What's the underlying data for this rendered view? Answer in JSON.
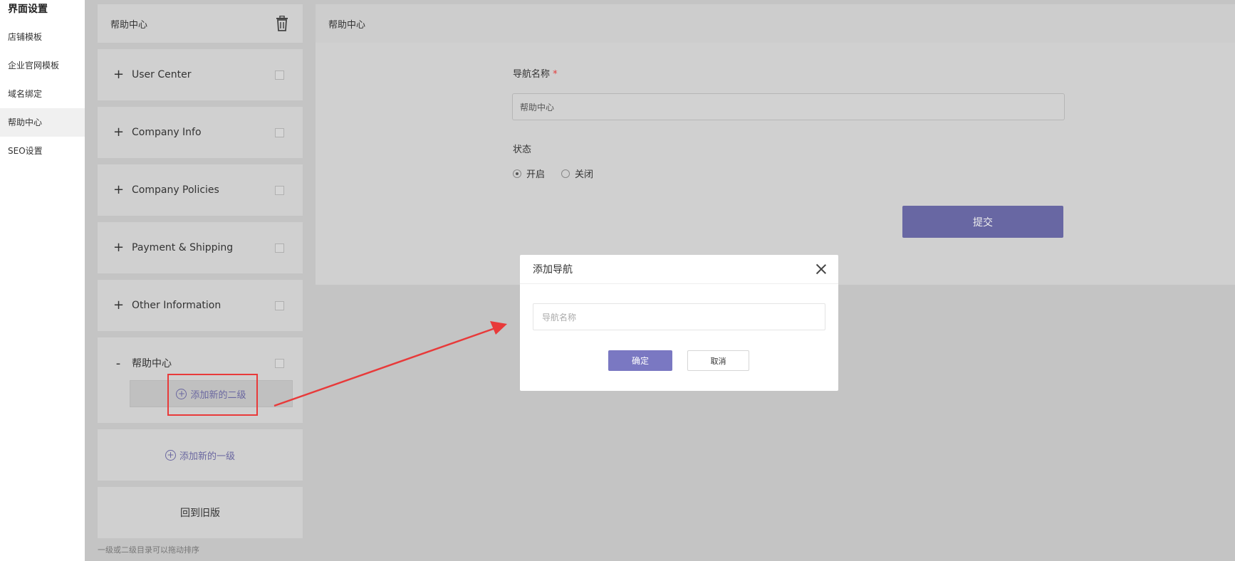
{
  "sidebar": {
    "title": "界面设置",
    "items": [
      {
        "label": "店铺模板"
      },
      {
        "label": "企业官网模板"
      },
      {
        "label": "域名绑定"
      },
      {
        "label": "帮助中心"
      },
      {
        "label": "SEO设置"
      }
    ]
  },
  "left_panel": {
    "title": "帮助中心",
    "rows": [
      {
        "sign": "+",
        "label": "User Center"
      },
      {
        "sign": "+",
        "label": "Company Info"
      },
      {
        "sign": "+",
        "label": "Company Policies"
      },
      {
        "sign": "+",
        "label": "Payment & Shipping"
      },
      {
        "sign": "+",
        "label": "Other Information"
      }
    ],
    "expanded": {
      "sign": "-",
      "label": "帮助中心",
      "add_sub_label": "添加新的二级"
    },
    "add_top_label": "添加新的一级",
    "back_old_label": "回到旧版",
    "hint": "一级或二级目录可以拖动排序"
  },
  "right_panel": {
    "title": "帮助中心",
    "name_label": "导航名称",
    "name_required": "*",
    "name_value": "帮助中心",
    "status_label": "状态",
    "status_options": [
      {
        "label": "开启",
        "selected": true
      },
      {
        "label": "关闭",
        "selected": false
      }
    ],
    "submit_label": "提交"
  },
  "modal": {
    "title": "添加导航",
    "input_placeholder": "导航名称",
    "ok_label": "确定",
    "cancel_label": "取消"
  },
  "colors": {
    "accent": "#6867a3",
    "ok_button": "#7a78c2",
    "annotation_red": "#e83a3a"
  }
}
